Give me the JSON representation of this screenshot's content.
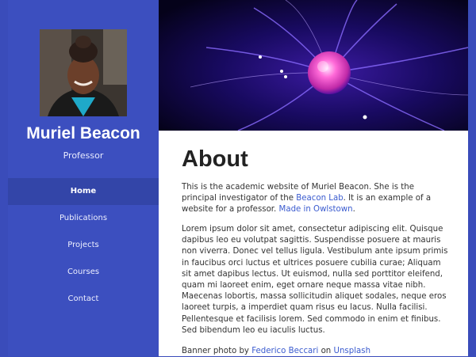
{
  "profile": {
    "name": "Muriel Beacon",
    "role": "Professor"
  },
  "nav": {
    "items": [
      {
        "label": "Home",
        "active": true
      },
      {
        "label": "Publications"
      },
      {
        "label": "Projects"
      },
      {
        "label": "Courses"
      },
      {
        "label": "Contact"
      }
    ]
  },
  "main": {
    "title": "About",
    "intro": {
      "text1": "This is the academic website of Muriel Beacon. She is the principal investigator of the ",
      "link1": "Beacon Lab",
      "text2": ". It is an example of a website for a professor. ",
      "link2": "Made in Owlstown",
      "text3": "."
    },
    "lorem": "Lorem ipsum dolor sit amet, consectetur adipiscing elit. Quisque dapibus leo eu volutpat sagittis. Suspendisse posuere at mauris non viverra. Donec vel tellus ligula. Vestibulum ante ipsum primis in faucibus orci luctus et ultrices posuere cubilia curae; Aliquam sit amet dapibus lectus. Ut euismod, nulla sed porttitor eleifend, quam mi laoreet enim, eget ornare neque massa vitae nibh. Maecenas lobortis, massa sollicitudin aliquet sodales, neque eros laoreet turpis, a imperdiet quam risus eu lacus. Nulla facilisi. Pellentesque et facilisis lorem. Sed commodo in enim et finibus. Sed bibendum leo eu iaculis luctus.",
    "credit": {
      "prefix": "Banner photo by ",
      "author": "Federico Beccari",
      "middle": " on ",
      "site": "Unsplash"
    }
  },
  "colors": {
    "sidebar": "#3c4fbf",
    "active_nav": "#3345a8",
    "link": "#3a5bcf"
  }
}
